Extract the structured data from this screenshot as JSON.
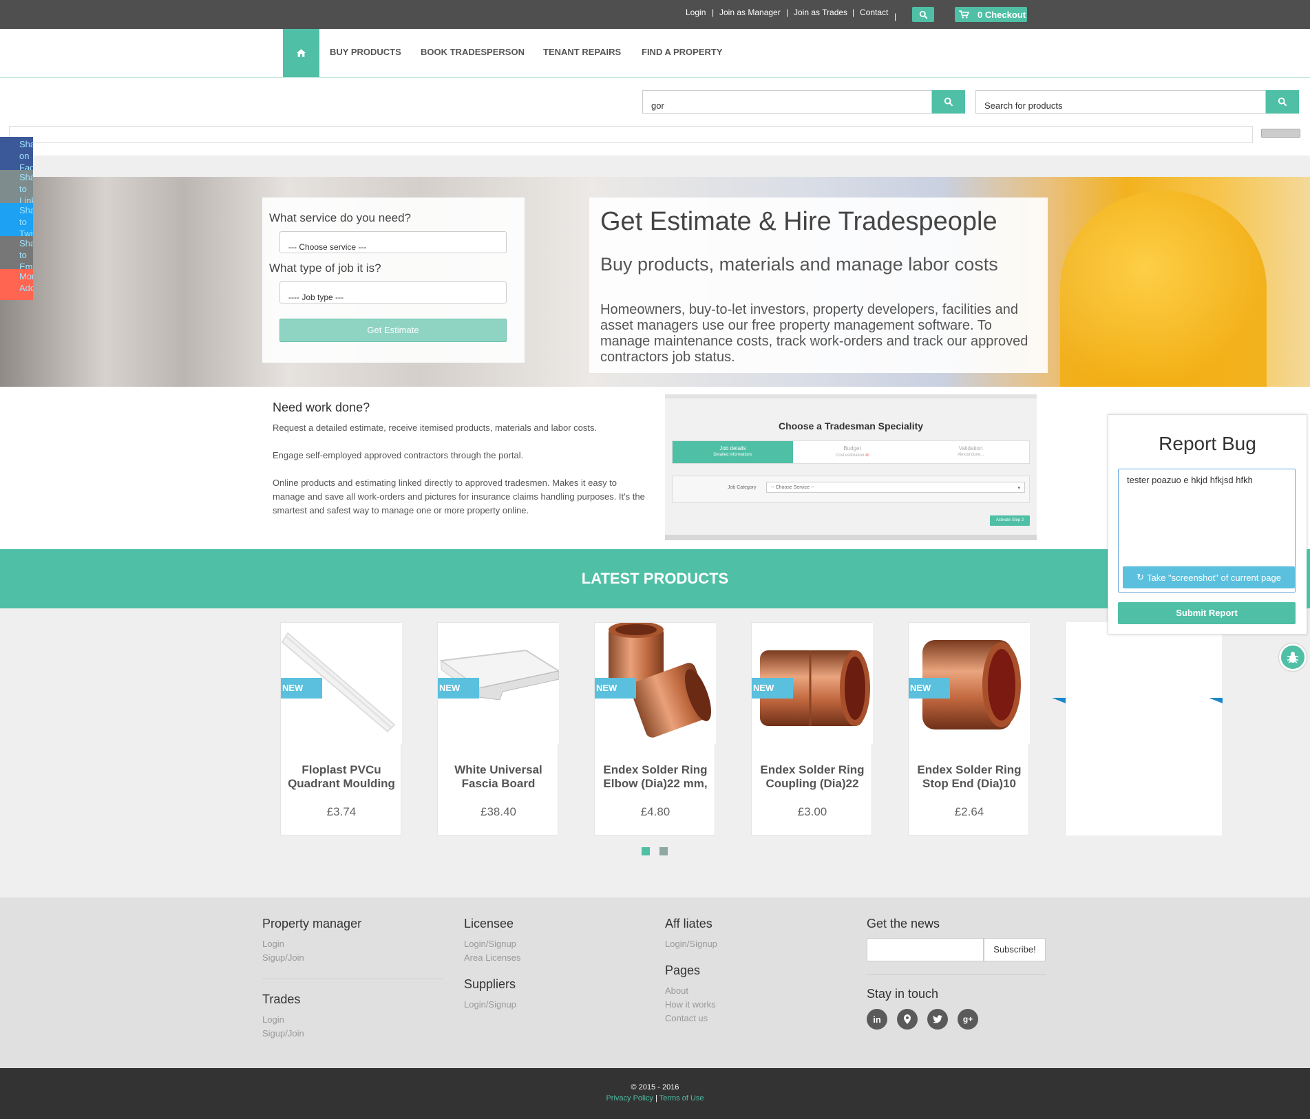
{
  "topbar": {
    "links": [
      "Login",
      "Join as Manager",
      "Join as Trades",
      "Contact"
    ],
    "checkout_label": "0 Checkout"
  },
  "nav": {
    "items": [
      "BUY PRODUCTS",
      "BOOK TRADESPERSON",
      "TENANT REPAIRS",
      "FIND A PROPERTY"
    ]
  },
  "search": {
    "main_value": "gor",
    "products_placeholder": "Search for products"
  },
  "share": {
    "items": [
      {
        "text": "Share on Facebook",
        "color": "#3b5998"
      },
      {
        "text": "Share to Linkedin",
        "color": "#7f8c8d"
      },
      {
        "text": "Share to Twitter",
        "color": "#1da1f2"
      },
      {
        "text": "Share to Email",
        "color": "#777777"
      },
      {
        "text": "More AddThis",
        "color": "#ff6550"
      }
    ]
  },
  "hero": {
    "service_label": "What service do you need?",
    "service_value": "--- Choose service ---",
    "job_label": "What type of job it is?",
    "job_value": "---- Job type ---",
    "estimate_button": "Get Estimate",
    "title": "Get Estimate & Hire Tradespeople",
    "subtitle": "Buy products, materials and manage labor costs",
    "description": "Homeowners, buy-to-let investors, property developers, facilities and asset managers use our free property management software. To manage maintenance costs, track work-orders and track our approved contractors job status."
  },
  "work": {
    "heading": "Need work done?",
    "p1": "Request a detailed estimate, receive itemised products, materials and labor costs.",
    "p2": "Engage self-employed approved contractors through the portal.",
    "p3": "Online products and estimating linked directly to approved tradesmen. Makes it easy to manage and save all work-orders and pictures for insurance claims handling purposes. It's the smartest and safest way to manage one or more property online."
  },
  "tradesman": {
    "title": "Choose a Tradesman Speciality",
    "steps": [
      {
        "name": "Job details",
        "sub": "Detailed informations"
      },
      {
        "name": "Budget",
        "sub": "Cost estimation"
      },
      {
        "name": "Validation",
        "sub": "Almost done..."
      }
    ],
    "category_label": "Job Category",
    "category_value": "-- Choose Service --",
    "next_button": "Activate Step 2"
  },
  "latest": {
    "heading": "LATEST PRODUCTS",
    "badge": "NEW",
    "products": [
      {
        "name": "Floplast PVCu Quadrant Moulding",
        "price": "£3.74"
      },
      {
        "name": "White Universal Fascia Board",
        "price": "£38.40"
      },
      {
        "name": "Endex Solder Ring Elbow (Dia)22 mm,",
        "price": "£4.80"
      },
      {
        "name": "Endex Solder Ring Coupling (Dia)22",
        "price": "£3.00"
      },
      {
        "name": "Endex Solder Ring Stop End (Dia)10",
        "price": "£2.64"
      }
    ]
  },
  "report": {
    "title": "Report Bug",
    "text": "tester poazuo e hkjd hfkjsd hfkh",
    "screenshot_button": "Take \"screenshot\" of current page",
    "submit_button": "Submit Report"
  },
  "footer": {
    "property_manager": {
      "title": "Property manager",
      "links": [
        "Login",
        "Sigup/Join"
      ]
    },
    "trades": {
      "title": "Trades",
      "links": [
        "Login",
        "Sigup/Join"
      ]
    },
    "licensee": {
      "title": "Licensee",
      "links": [
        "Login/Signup",
        "Area Licenses"
      ]
    },
    "suppliers": {
      "title": "Suppliers",
      "links": [
        "Login/Signup"
      ]
    },
    "affiliates": {
      "title": "Aff liates",
      "links": [
        "Login/Signup"
      ]
    },
    "pages": {
      "title": "Pages",
      "links": [
        "About",
        "How it works",
        "Contact us"
      ]
    },
    "news": {
      "title": "Get the news",
      "subscribe": "Subscribe!"
    },
    "stay": {
      "title": "Stay in touch",
      "icons": [
        "linkedin-icon",
        "map-marker-icon",
        "twitter-icon",
        "google-plus-icon"
      ]
    }
  },
  "bottom": {
    "copyright": "© 2015 - 2016",
    "privacy": "Privacy Policy",
    "sep": "|",
    "terms": "Terms of Use"
  },
  "colors": {
    "accent": "#4fbfa5",
    "topbar": "#4f4f4f",
    "badge": "#5bc0de"
  }
}
